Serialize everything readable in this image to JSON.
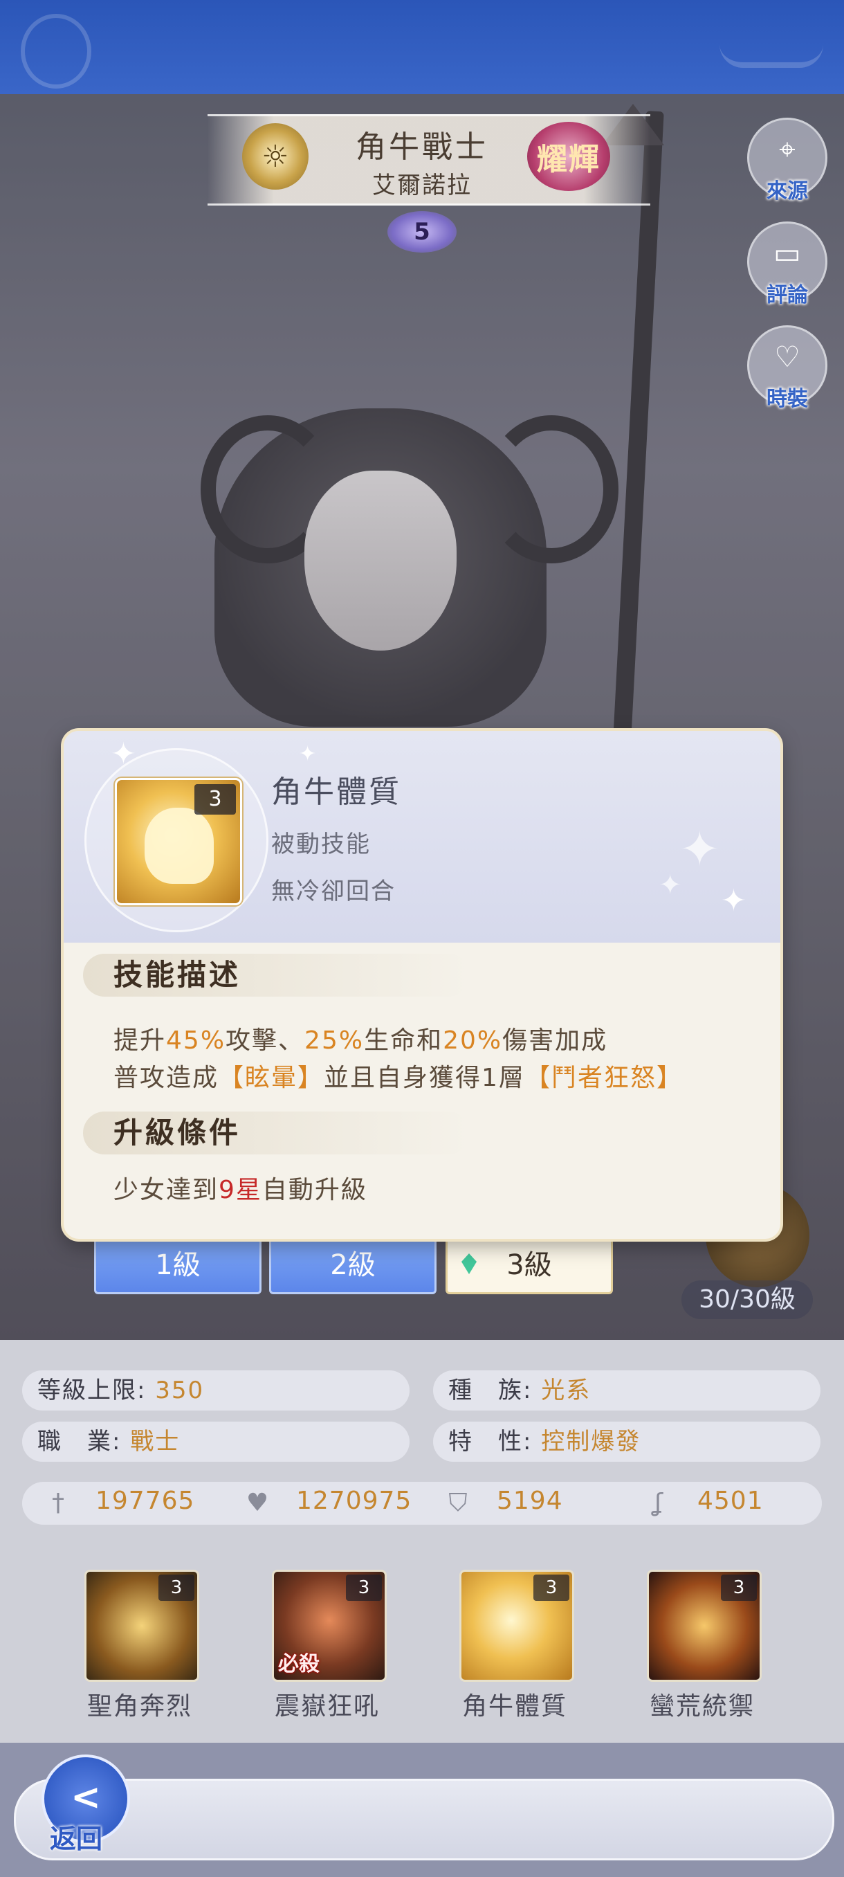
{
  "character": {
    "name": "角牛戰士",
    "subname": "艾爾諾拉",
    "rarity_label": "耀輝",
    "stars": "5",
    "class_icon": "sun-wheel-icon"
  },
  "side_buttons": [
    {
      "label": "來源",
      "icon": "location-pin-icon"
    },
    {
      "label": "評論",
      "icon": "chat-icon"
    },
    {
      "label": "時裝",
      "icon": "outfit-icon"
    }
  ],
  "popup": {
    "skill_level": "3",
    "skill_name": "角牛體質",
    "skill_type": "被動技能",
    "cooldown": "無冷卻回合",
    "desc_title": "技能描述",
    "desc_line1": {
      "p1": "提升",
      "v1": "45%",
      "p2": "攻擊、",
      "v2": "25%",
      "p3": "生命和",
      "v3": "20%",
      "p4": "傷害加成"
    },
    "desc_line2": {
      "p1": "普攻造成",
      "v1": "【眩暈】",
      "p2": "並且自身獲得1層",
      "v2": "【鬥者狂怒】"
    },
    "upgrade_title": "升級條件",
    "upgrade": {
      "p1": "少女達到",
      "v1": "9星",
      "p2": "自動升級"
    }
  },
  "level_tabs": [
    "1級",
    "2級",
    "3級"
  ],
  "level_count": "30/30級",
  "info": {
    "level_cap_label": "等級上限:",
    "level_cap": "350",
    "race_label": "種　族:",
    "race": "光系",
    "job_label": "職　業:",
    "job": "戰士",
    "trait_label": "特　性:",
    "trait": "控制爆發"
  },
  "stats": [
    {
      "icon": "sword-icon",
      "value": "197765"
    },
    {
      "icon": "heart-icon",
      "value": "1270975"
    },
    {
      "icon": "shield-icon",
      "value": "5194"
    },
    {
      "icon": "boot-icon",
      "value": "4501"
    }
  ],
  "skills": [
    {
      "name": "聖角奔烈",
      "level": "3",
      "tag": ""
    },
    {
      "name": "震嶽狂吼",
      "level": "3",
      "tag": "必殺"
    },
    {
      "name": "角牛體質",
      "level": "3",
      "tag": ""
    },
    {
      "name": "蠻荒統禦",
      "level": "3",
      "tag": ""
    }
  ],
  "back_label": "返回",
  "colors": {
    "accent_blue": "#3463c6",
    "highlight_orange": "#d98422",
    "highlight_red": "#c62828"
  }
}
